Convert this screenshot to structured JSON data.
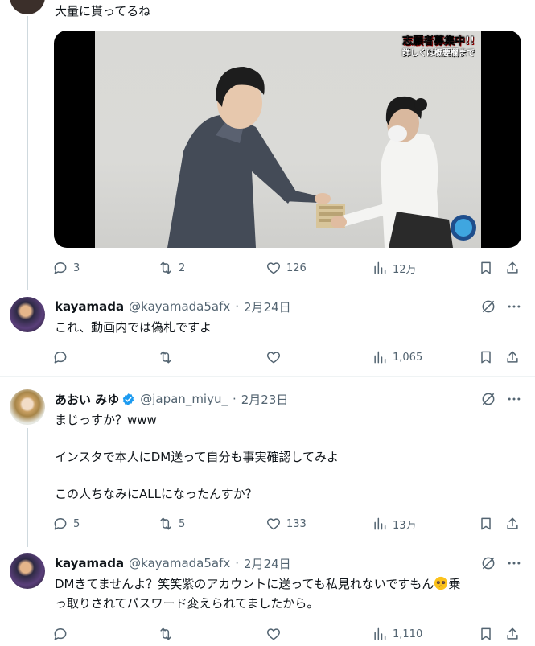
{
  "top_tweet": {
    "text": "大量に貰ってるね",
    "video_overlay": {
      "line1": "志願者募集中!!",
      "line2": "詳しくは概要欄まで"
    },
    "actions": {
      "replies": "3",
      "retweets": "2",
      "likes": "126",
      "views": "12万"
    }
  },
  "replies": [
    {
      "name": "kayamada",
      "handle": "@kayamada5afx",
      "sep": "·",
      "date": "2月24日",
      "text": "これ、動画内では偽札ですよ",
      "actions": {
        "replies": "",
        "retweets": "",
        "likes": "",
        "views": "1,065"
      }
    },
    {
      "name": "あおい みゆ",
      "handle": "@japan_miyu_",
      "sep": "·",
      "date": "2月23日",
      "lines": [
        "まじっすか？www",
        "インスタで本人にDM送って自分も事実確認してみよ",
        "この人ちなみにALLになったんすか？"
      ],
      "actions": {
        "replies": "5",
        "retweets": "5",
        "likes": "133",
        "views": "13万"
      }
    },
    {
      "name": "kayamada",
      "handle": "@kayamada5afx",
      "sep": "·",
      "date": "2月24日",
      "line1": "DMきてませんよ？笑笑紫のアカウントに送っても私見れないですもん",
      "line1_end": "乗",
      "line2": "っ取りされてパスワード変えられてましたから。",
      "actions": {
        "replies": "",
        "retweets": "",
        "likes": "",
        "views": "1,110"
      }
    }
  ],
  "icons": [
    "reply-icon",
    "retweet-icon",
    "like-icon",
    "views-icon",
    "bookmark-icon",
    "share-icon",
    "grok-icon",
    "more-icon",
    "verified-icon",
    "pleading-face-emoji"
  ],
  "colors": {
    "verified": "#1d9bf0",
    "muted": "#536471",
    "divider": "#eff3f4"
  }
}
